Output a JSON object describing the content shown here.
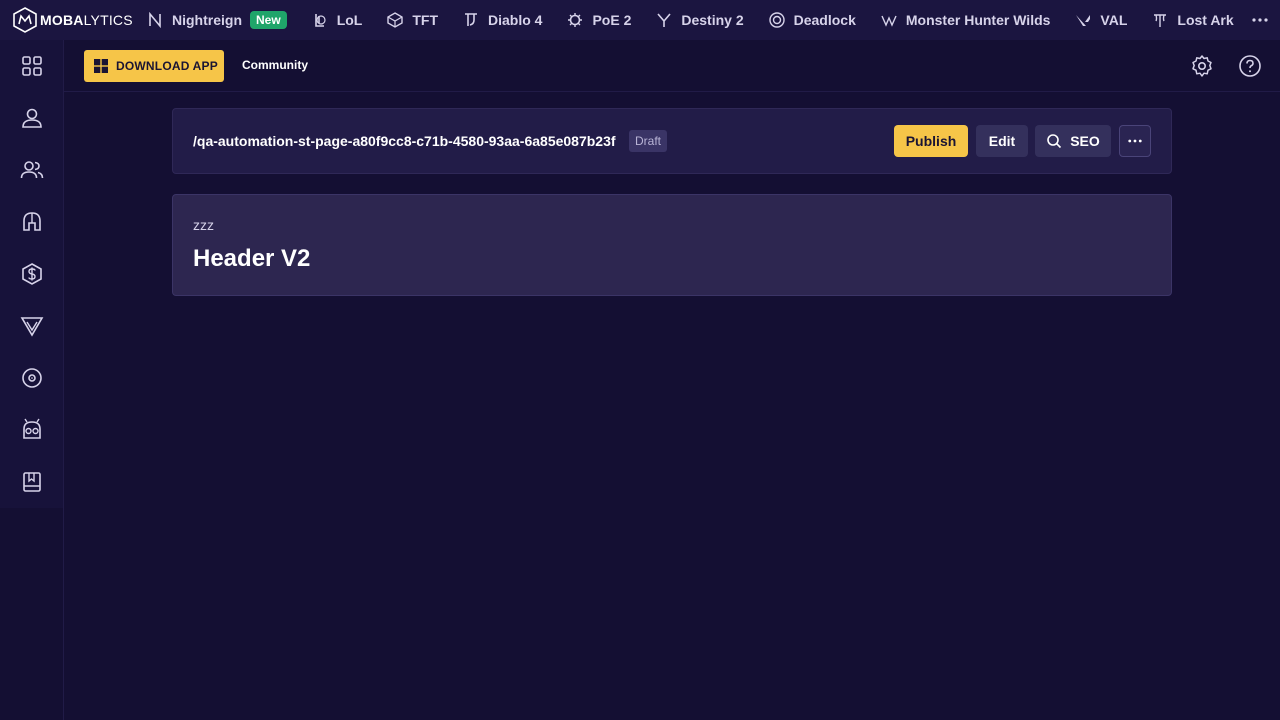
{
  "brand": {
    "name_bold": "MOBA",
    "name_light": "LYTICS",
    "logo_icon": "mobalytics-logo-icon"
  },
  "nav": {
    "items": [
      {
        "label": "Nightreign",
        "icon": "nightreign-icon",
        "badge": "New"
      },
      {
        "label": "LoL",
        "icon": "lol-icon"
      },
      {
        "label": "TFT",
        "icon": "tft-icon"
      },
      {
        "label": "Diablo 4",
        "icon": "diablo-icon"
      },
      {
        "label": "PoE 2",
        "icon": "poe-icon"
      },
      {
        "label": "Destiny 2",
        "icon": "destiny-icon"
      },
      {
        "label": "Deadlock",
        "icon": "deadlock-icon"
      },
      {
        "label": "Monster Hunter Wilds",
        "icon": "monster-hunter-icon"
      },
      {
        "label": "VAL",
        "icon": "valorant-icon"
      },
      {
        "label": "Lost Ark",
        "icon": "lost-ark-icon"
      }
    ],
    "more_icon": "more-horizontal-icon"
  },
  "sidebar": {
    "icons": [
      "grid-icon",
      "user-icon",
      "users-icon",
      "helmet-icon",
      "dollar-shield-icon",
      "v-shield-icon",
      "disc-icon",
      "robot-icon",
      "book-icon"
    ]
  },
  "subheader": {
    "download_label": "DOWNLOAD APP",
    "community_label": "Community",
    "settings_icon": "gear-icon",
    "help_icon": "help-icon"
  },
  "page": {
    "path": "/qa-automation-st-page-a80f9cc8-c71b-4580-93aa-6a85e087b23f",
    "status": "Draft",
    "publish_label": "Publish",
    "edit_label": "Edit",
    "seo_label": "SEO"
  },
  "content": {
    "kicker": "zzz",
    "title": "Header V2"
  },
  "colors": {
    "accent": "#f6c548",
    "background": "#140f33",
    "new_badge": "#1fa56a"
  }
}
